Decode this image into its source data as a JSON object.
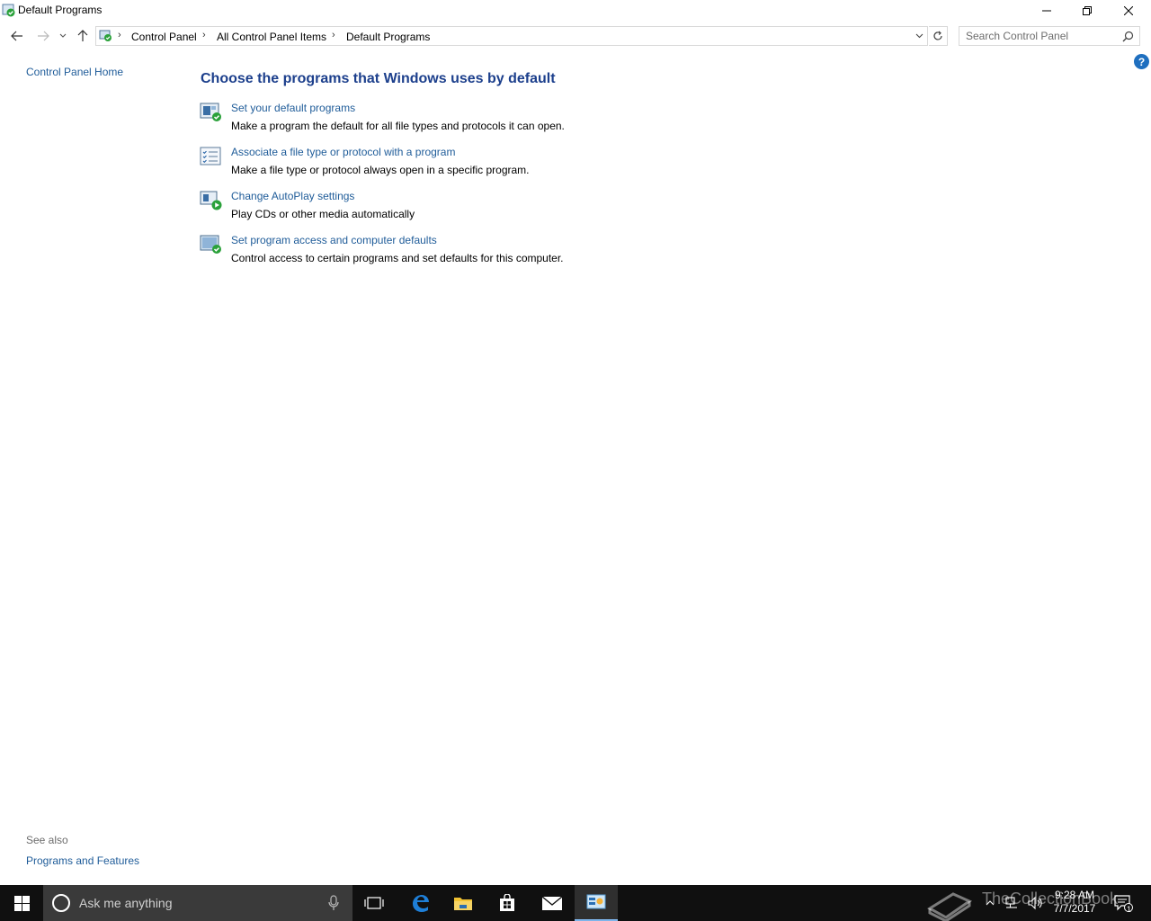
{
  "window": {
    "title": "Default Programs"
  },
  "address": {
    "crumbs": [
      "Control Panel",
      "All Control Panel Items",
      "Default Programs"
    ]
  },
  "search": {
    "placeholder": "Search Control Panel"
  },
  "left_pane": {
    "home_link": "Control Panel Home",
    "see_also_label": "See also",
    "see_also_links": [
      "Programs and Features"
    ]
  },
  "main": {
    "help_glyph": "?",
    "heading": "Choose the programs that Windows uses by default",
    "tasks": [
      {
        "icon": "default-programs-icon",
        "link": "Set your default programs",
        "desc": "Make a program the default for all file types and protocols it can open."
      },
      {
        "icon": "file-association-icon",
        "link": "Associate a file type or protocol with a program",
        "desc": "Make a file type or protocol always open in a specific program."
      },
      {
        "icon": "autoplay-icon",
        "link": "Change AutoPlay settings",
        "desc": "Play CDs or other media automatically"
      },
      {
        "icon": "program-access-icon",
        "link": "Set program access and computer defaults",
        "desc": "Control access to certain programs and set defaults for this computer."
      }
    ]
  },
  "taskbar": {
    "search_text": "Ask me anything",
    "time": "9:28 AM",
    "date": "7/7/2017",
    "notification_count": "1",
    "watermark": "TheCollectionBook"
  },
  "colors": {
    "link": "#1f5c99",
    "heading": "#1c3f8c",
    "taskbar": "#101010",
    "cortana_box": "#3a3a3a"
  }
}
